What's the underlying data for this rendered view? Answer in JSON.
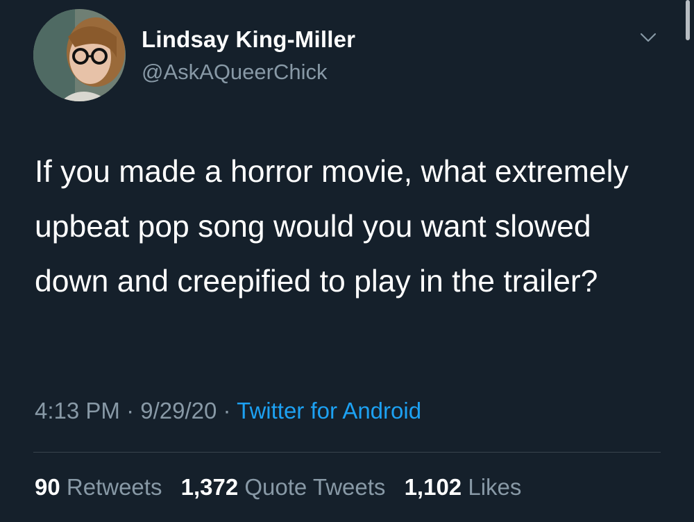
{
  "author": {
    "display_name": "Lindsay King-Miller",
    "handle": "@AskAQueerChick",
    "avatar_icon": "profile-photo"
  },
  "menu_icon": "chevron-down-icon",
  "tweet": {
    "text": "If you made a horror movie, what extremely upbeat pop song would you want slowed down and creepified to play in the trailer?",
    "time": "4:13 PM",
    "separator": "·",
    "date": "9/29/20",
    "source": "Twitter for Android"
  },
  "stats": {
    "retweets_count": "90",
    "retweets_label": "Retweets",
    "quotes_count": "1,372",
    "quotes_label": "Quote Tweets",
    "likes_count": "1,102",
    "likes_label": "Likes"
  },
  "colors": {
    "background": "#15202b",
    "secondary_text": "#8899a6",
    "link": "#1da1f2",
    "divider": "#38444d"
  }
}
